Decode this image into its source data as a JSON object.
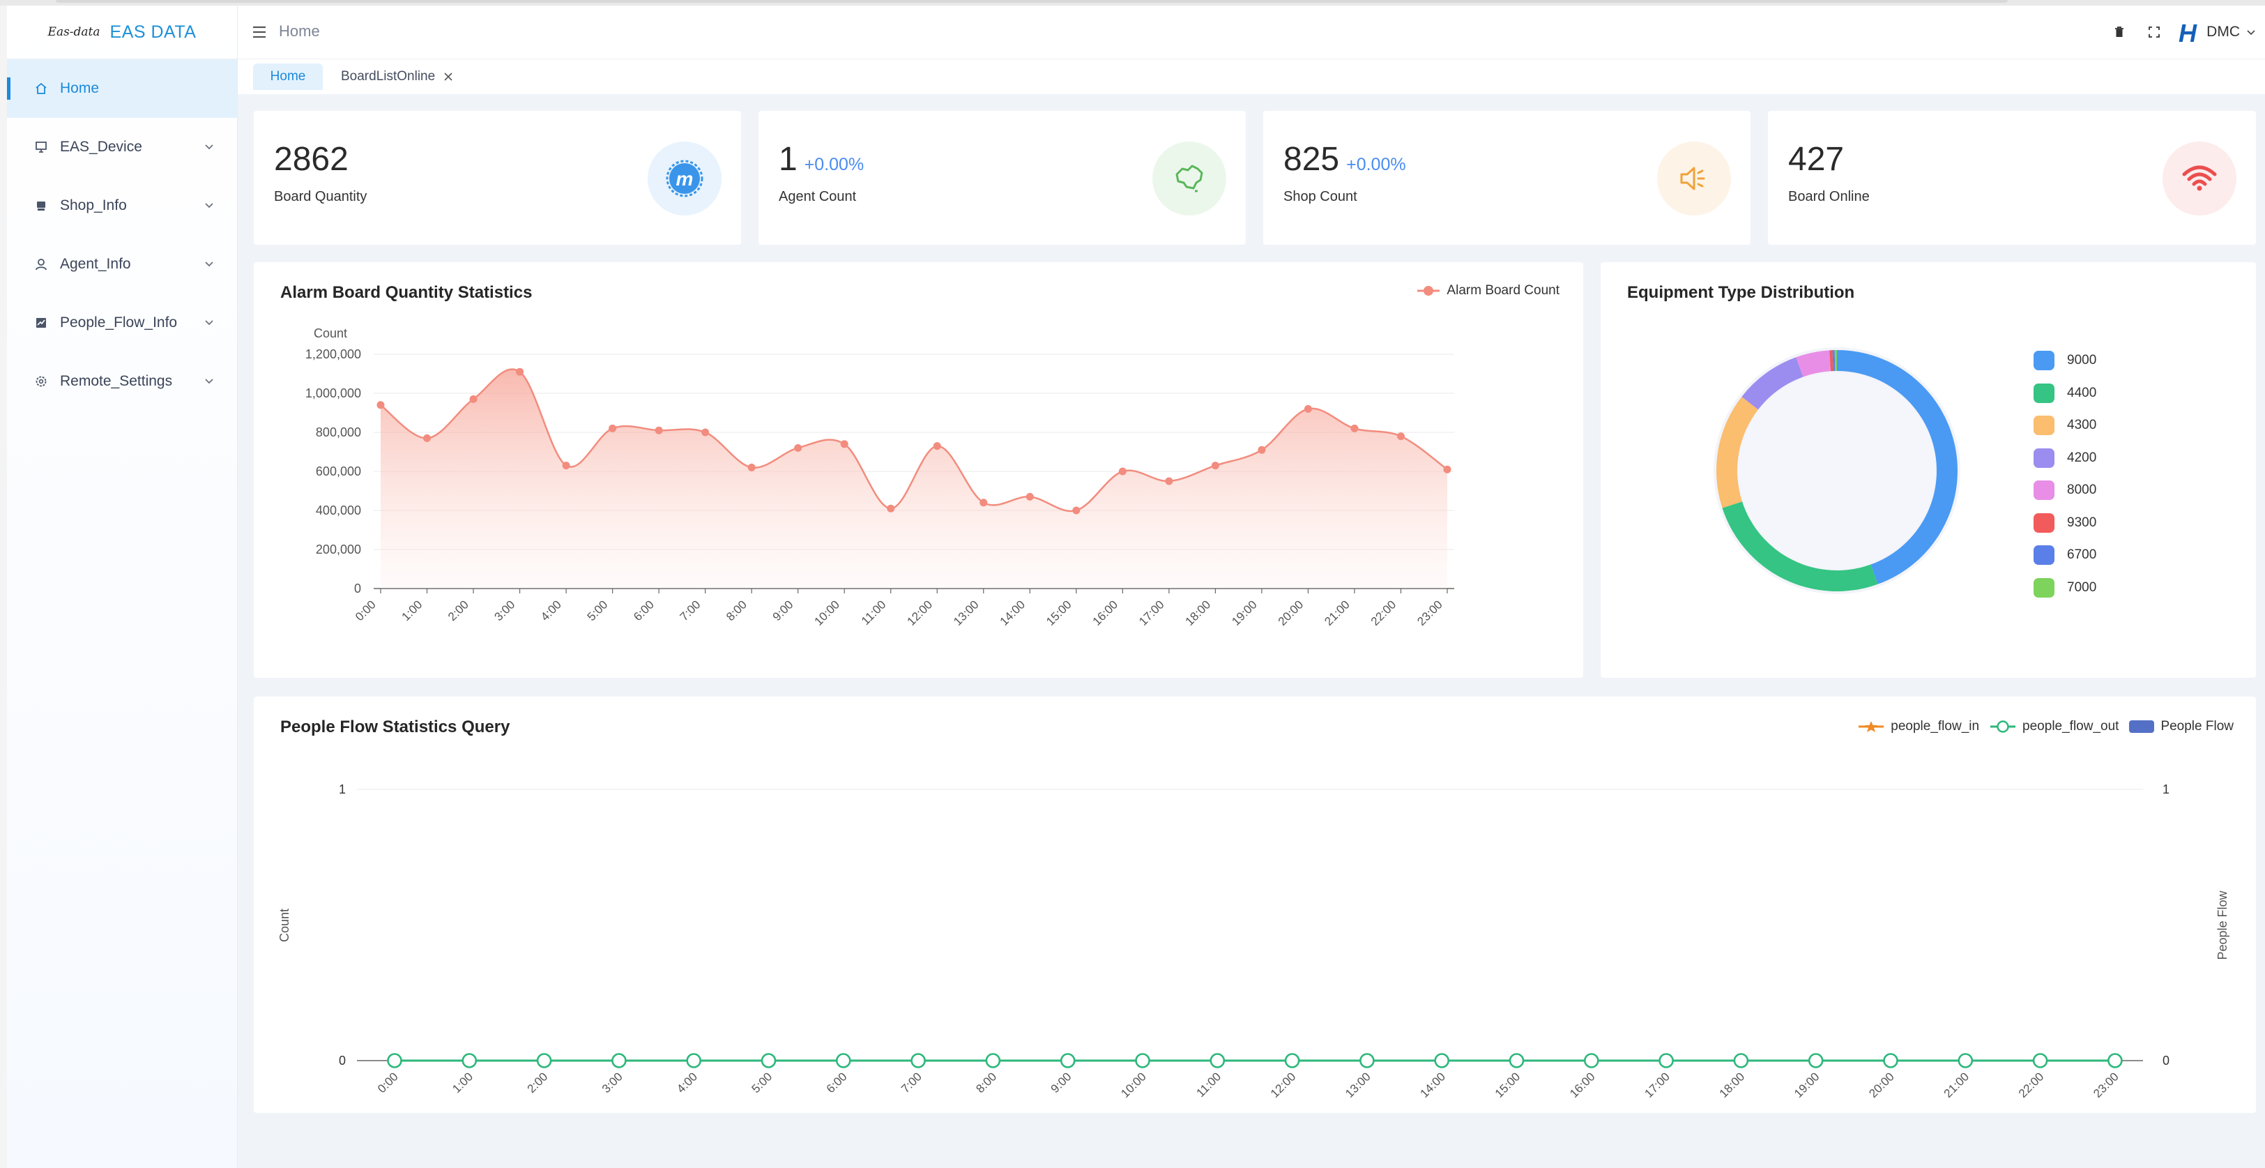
{
  "app": {
    "logo_script": "Eas-data",
    "logo_text": "EAS DATA"
  },
  "sidebar": {
    "items": [
      {
        "label": "Home",
        "icon": "home-icon"
      },
      {
        "label": "EAS_Device",
        "icon": "monitor-icon"
      },
      {
        "label": "Shop_Info",
        "icon": "store-icon"
      },
      {
        "label": "Agent_Info",
        "icon": "user-icon"
      },
      {
        "label": "People_Flow_Info",
        "icon": "chart-icon"
      },
      {
        "label": "Remote_Settings",
        "icon": "gear-icon"
      }
    ]
  },
  "header": {
    "breadcrumb": "Home",
    "user": "DMC"
  },
  "tabs": [
    {
      "label": "Home"
    },
    {
      "label": "BoardListOnline"
    }
  ],
  "stats": [
    {
      "value": "2862",
      "change": "",
      "label": "Board Quantity",
      "icon": "badge-m-icon",
      "color": "#3a95ea",
      "bg": "#e8f3fd"
    },
    {
      "value": "1",
      "change": "+0.00%",
      "label": "Agent Count",
      "icon": "map-china-icon",
      "color": "#5ab75a",
      "bg": "#ecf7ec"
    },
    {
      "value": "825",
      "change": "+0.00%",
      "label": "Shop Count",
      "icon": "speaker-icon",
      "color": "#f0a33a",
      "bg": "#fdf3e7"
    },
    {
      "value": "427",
      "change": "",
      "label": "Board Online",
      "icon": "wifi-icon",
      "color": "#ea4f4f",
      "bg": "#fdecec"
    }
  ],
  "alarm_chart": {
    "title": "Alarm Board Quantity Statistics",
    "legend": "Alarm Board Count",
    "ylabel": "Count",
    "color": "#f28c7e"
  },
  "donut_chart": {
    "title": "Equipment Type Distribution"
  },
  "people_chart": {
    "title": "People Flow Statistics Query",
    "ylabel_left": "Count",
    "ylabel_right": "People Flow",
    "legend": [
      {
        "name": "people_flow_in",
        "color": "#f08a24"
      },
      {
        "name": "people_flow_out",
        "color": "#2db77b"
      },
      {
        "name": "People Flow",
        "color": "#5470c6"
      }
    ]
  },
  "chart_data": [
    {
      "type": "area",
      "title": "Alarm Board Quantity Statistics",
      "ylabel": "Count",
      "ylim": [
        0,
        1200000
      ],
      "yticks": [
        "0",
        "200,000",
        "400,000",
        "600,000",
        "800,000",
        "1,000,000",
        "1,200,000"
      ],
      "x": [
        "0:00",
        "1:00",
        "2:00",
        "3:00",
        "4:00",
        "5:00",
        "6:00",
        "7:00",
        "8:00",
        "9:00",
        "10:00",
        "11:00",
        "12:00",
        "13:00",
        "14:00",
        "15:00",
        "16:00",
        "17:00",
        "18:00",
        "19:00",
        "20:00",
        "21:00",
        "22:00",
        "23:00"
      ],
      "series": [
        {
          "name": "Alarm Board Count",
          "values": [
            940000,
            770000,
            970000,
            1110000,
            630000,
            820000,
            810000,
            800000,
            620000,
            720000,
            740000,
            410000,
            730000,
            440000,
            470000,
            400000,
            600000,
            550000,
            630000,
            710000,
            920000,
            820000,
            780000,
            610000
          ]
        }
      ],
      "grid": true,
      "legend": "top-right"
    },
    {
      "type": "pie",
      "title": "Equipment Type Distribution",
      "categories": [
        "9000",
        "4400",
        "4300",
        "4200",
        "8000",
        "9300",
        "6700",
        "7000"
      ],
      "values": [
        44.5,
        25.5,
        15.5,
        9,
        4.5,
        0.4,
        0.3,
        0.3
      ],
      "colors": [
        "#4a9af4",
        "#35c483",
        "#fbbd6e",
        "#9b8df0",
        "#e88ee6",
        "#f25b5b",
        "#5b7fe8",
        "#7dd35b"
      ],
      "legend": "right"
    },
    {
      "type": "line",
      "title": "People Flow Statistics Query",
      "ylabel": "Count",
      "ylabel_right": "People Flow",
      "ylim": [
        0,
        1
      ],
      "x": [
        "0:00",
        "1:00",
        "2:00",
        "3:00",
        "4:00",
        "5:00",
        "6:00",
        "7:00",
        "8:00",
        "9:00",
        "10:00",
        "11:00",
        "12:00",
        "13:00",
        "14:00",
        "15:00",
        "16:00",
        "17:00",
        "18:00",
        "19:00",
        "20:00",
        "21:00",
        "22:00",
        "23:00"
      ],
      "series": [
        {
          "name": "people_flow_in",
          "values": [
            0,
            0,
            0,
            0,
            0,
            0,
            0,
            0,
            0,
            0,
            0,
            0,
            0,
            0,
            0,
            0,
            0,
            0,
            0,
            0,
            0,
            0,
            0,
            0
          ]
        },
        {
          "name": "people_flow_out",
          "values": [
            0,
            0,
            0,
            0,
            0,
            0,
            0,
            0,
            0,
            0,
            0,
            0,
            0,
            0,
            0,
            0,
            0,
            0,
            0,
            0,
            0,
            0,
            0,
            0
          ]
        },
        {
          "name": "People Flow",
          "values": [
            0,
            0,
            0,
            0,
            0,
            0,
            0,
            0,
            0,
            0,
            0,
            0,
            0,
            0,
            0,
            0,
            0,
            0,
            0,
            0,
            0,
            0,
            0,
            0
          ]
        }
      ],
      "grid": true,
      "legend": "top-right"
    }
  ]
}
